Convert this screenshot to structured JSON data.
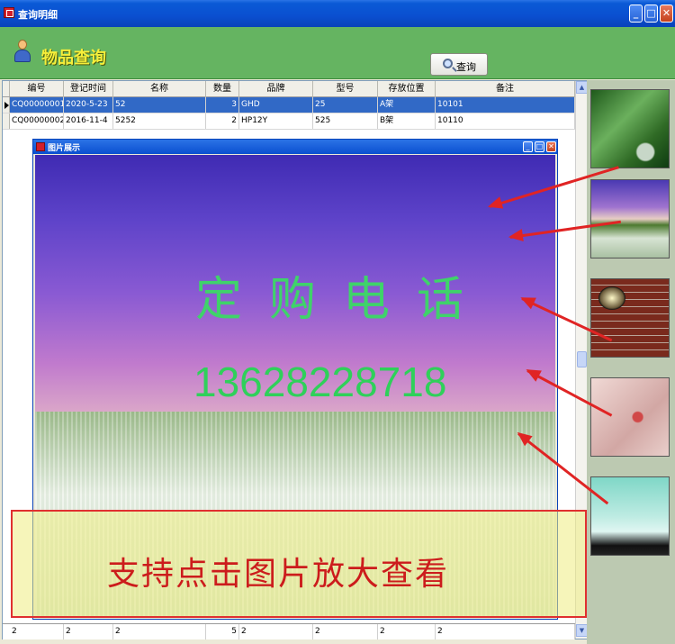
{
  "window": {
    "title": "查询明细",
    "minimize_icon": "minimize-icon",
    "maximize_icon": "maximize-icon",
    "close_icon": "close-icon"
  },
  "header": {
    "title": "物品查询",
    "icon": "person-icon",
    "search_label": "查询"
  },
  "table": {
    "columns": [
      "编号",
      "登记时间",
      "名称",
      "数量",
      "品牌",
      "型号",
      "存放位置",
      "备注"
    ],
    "rows": [
      [
        "CQ00000001",
        "2020-5-23",
        "52",
        "3",
        "GHD",
        "25",
        "A架",
        "10101"
      ],
      [
        "CQ00000002",
        "2016-11-4",
        "5252",
        "2",
        "HP12Y",
        "525",
        "B架",
        "10110"
      ]
    ],
    "footer": [
      "2",
      "2",
      "2",
      "5",
      "2",
      "2",
      "2",
      "2"
    ],
    "selected_row_index": 0
  },
  "popup": {
    "title": "图片展示",
    "overlay_line1": "定购电话",
    "overlay_line2": "13628228718"
  },
  "notice": {
    "text": "支持点击图片放大查看"
  },
  "colors": {
    "header_bg": "#65b461",
    "header_title": "#f6ee3a",
    "selection": "#3169c6",
    "overlay_text": "#3fd36a",
    "notice_text": "#cc1c1c",
    "arrow": "#e02424"
  }
}
